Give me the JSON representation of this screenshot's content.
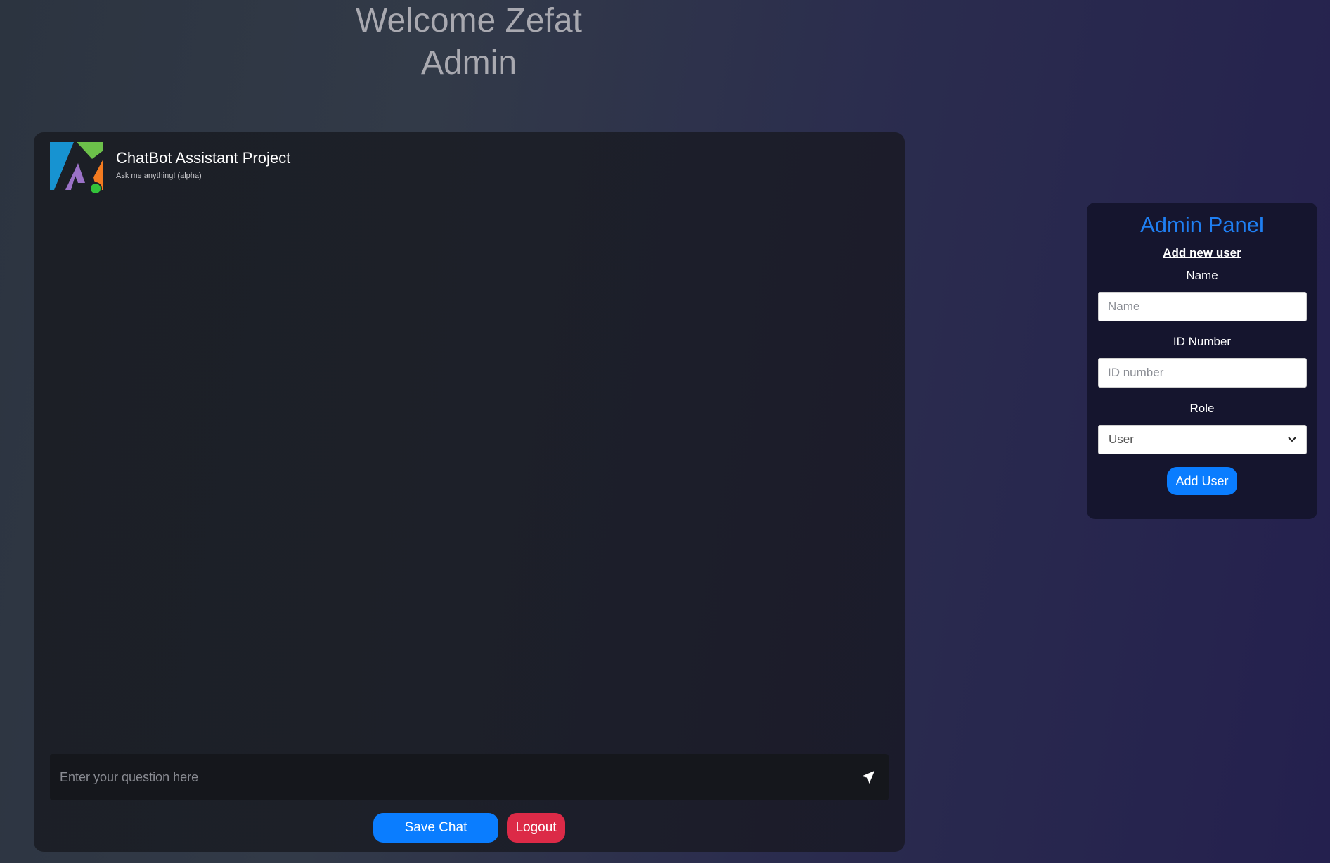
{
  "page": {
    "title": "Welcome Zefat Admin"
  },
  "chat": {
    "title": "ChatBot Assistant Project",
    "subtitle": "Ask me anything! (alpha)",
    "status": "online",
    "logo_colors": {
      "blue": "#1793d1",
      "green": "#6cc04a",
      "orange": "#f47b20",
      "purple": "#9b72c8"
    },
    "input": {
      "placeholder": "Enter your question here",
      "value": ""
    },
    "send_icon": "paper-plane-icon",
    "save_label": "Save Chat",
    "logout_label": "Logout"
  },
  "admin": {
    "title": "Admin Panel",
    "add_new_user_label": "Add new user",
    "name_label": "Name",
    "name_placeholder": "Name",
    "id_label": "ID Number",
    "id_placeholder": "ID number",
    "role_label": "Role",
    "role_selected": "User",
    "add_user_label": "Add User"
  },
  "colors": {
    "accent": "#0a7dff",
    "danger": "#dc2a47",
    "admin_title": "#1f7ff2",
    "online": "#33c33a"
  }
}
